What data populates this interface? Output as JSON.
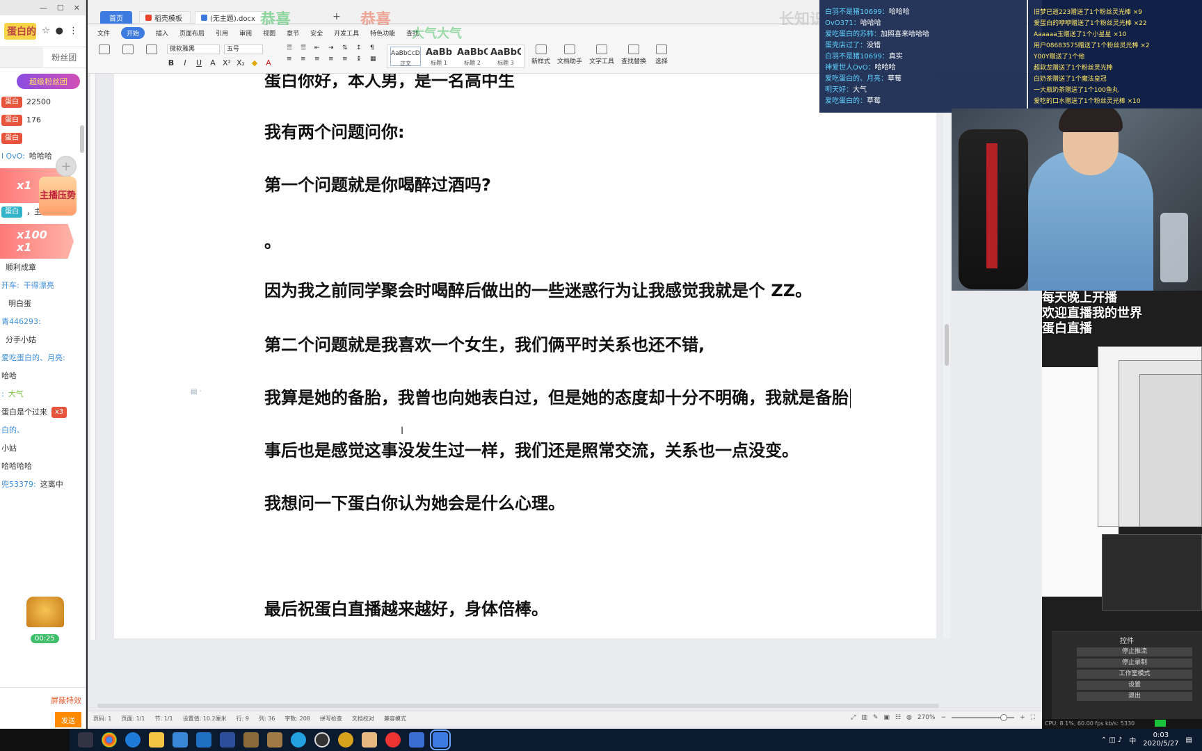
{
  "left_panel": {
    "logo_text": "蛋白的峡",
    "tabs": [
      "",
      "粉丝团"
    ],
    "banner": "超级粉丝团",
    "chat": [
      {
        "badge": "蛋白",
        "name": "",
        "msg": "22500"
      },
      {
        "badge": "蛋白",
        "name": "",
        "msg": "176"
      },
      {
        "badge": "蛋白",
        "name": "",
        "msg": ""
      },
      {
        "badge": "",
        "name": "l OvO:",
        "msg": "哈哈哈"
      },
      {
        "badge": "蛋白",
        "name": "",
        "msg": "，主播"
      },
      {
        "badge": "",
        "name": "",
        "msg": "顺利成章"
      },
      {
        "badge": "",
        "name": "开车:",
        "msg": "干得漂亮"
      },
      {
        "badge": "",
        "name": "",
        "msg": "明白蛋"
      },
      {
        "badge": "",
        "name": "青446293:",
        "msg": ""
      },
      {
        "badge": "",
        "name": "",
        "msg": "分手小姑"
      },
      {
        "badge": "",
        "name": "爱吃蛋白的、月亮:",
        "msg": ""
      },
      {
        "badge": "",
        "name": "",
        "msg": "哈哈"
      },
      {
        "badge": "",
        "name": ":",
        "msg": "大气"
      },
      {
        "badge": "",
        "name": "",
        "msg": "蛋白是个过来"
      },
      {
        "badge": "",
        "name": "白的、",
        "msg": ""
      },
      {
        "badge": "",
        "name": "",
        "msg": "小姑"
      },
      {
        "badge": "",
        "name": "",
        "msg": "哈哈哈哈"
      },
      {
        "badge": "",
        "name": "兜53379:",
        "msg": "这离中"
      }
    ],
    "gift_1": "x1",
    "gift_2": "x100",
    "gift_3": "x1",
    "mascot": "主播压势",
    "chest_badge": "x3",
    "timer": "00:25",
    "effect_label": "屏蔽特效",
    "send_label": "发送"
  },
  "wps": {
    "tabs": {
      "home": "首页",
      "docer": "稻壳模板",
      "doc": "(无主题).docx"
    },
    "overlay_1": "恭喜",
    "overlay_2": "恭喜",
    "overlay_3": "长知识了",
    "overlay_4": "大气大气",
    "menu": [
      "文件",
      "开始",
      "插入",
      "页面布局",
      "引用",
      "审阅",
      "视图",
      "章节",
      "安全",
      "开发工具",
      "特色功能",
      "查找"
    ],
    "active_menu": "开始",
    "font_name": "微软雅黑",
    "font_size": "五号",
    "styles": [
      {
        "preview": "AaBbCcDd",
        "name": "正文"
      },
      {
        "preview": "AaBb",
        "name": "标题 1"
      },
      {
        "preview": "AaBbC",
        "name": "标题 2"
      },
      {
        "preview": "AaBbC",
        "name": "标题 3"
      }
    ],
    "ribbon_tools": [
      "新样式",
      "文档助手",
      "文字工具",
      "查找替换",
      "选择"
    ],
    "document": [
      "蛋白你好，本人男，是一名高中生",
      "我有两个问题问你:",
      "第一个问题就是你喝醉过酒吗?",
      "。",
      "因为我之前同学聚会时喝醉后做出的一些迷惑行为让我感觉我就是个 ZZ。",
      "第二个问题就是我喜欢一个女生，我们俩平时关系也还不错,",
      "我算是她的备胎，我曾也向她表白过，但是她的态度却十分不明确，我就是备胎",
      "事后也是感觉这事没发生过一样，我们还是照常交流，关系也一点没变。",
      "我想问一下蛋白你认为她会是什么心理。",
      "最后祝蛋白直播越来越好，身体倍棒。"
    ],
    "status": [
      "页码: 1",
      "页面: 1/1",
      "节: 1/1",
      "设置值: 10.2厘米",
      "行: 9",
      "列: 36",
      "字数: 208",
      "拼写检查",
      "文档校对",
      "兼容模式"
    ],
    "zoom": "270%"
  },
  "stream": {
    "chat": [
      {
        "name": "白羽不是猪10699：",
        "msg": "哈哈哈"
      },
      {
        "name": "OvO371：",
        "msg": "哈哈哈"
      },
      {
        "name": "爱吃蛋白的苏柿：",
        "msg": "加照喜来哈哈哈"
      },
      {
        "name": "蛋壳店过了：",
        "msg": "没错"
      },
      {
        "name": "白羽不是猪10699：",
        "msg": "真实"
      },
      {
        "name": "神爱世人OvO：",
        "msg": "哈哈哈"
      },
      {
        "name": "爱吃蛋白的、月亮：",
        "msg": "草莓"
      },
      {
        "name": "明天好：",
        "msg": "大气"
      },
      {
        "name": "爱吃蛋白的：",
        "msg": "草莓"
      }
    ],
    "gifts": [
      "旧梦已逝223赠送了1个粉丝灵光棒 ×9",
      "爱蛋白的咿咿赠送了1个粉丝灵光棒 ×22",
      "Aaaaaa玉赠送了1个小星星 ×10",
      "用户08683575赠送了1个粉丝灵光棒 ×2",
      "Y00Y赠送了1个他",
      "超软龙赠送了1个粉丝灵光棒",
      "白奶茶赠送了1个魔法皇冠",
      "一大瓶奶茶赠送了1个100鱼丸",
      "爱吃的口水赠送了1个粉丝灵光棒 ×10"
    ],
    "obs_overlay": [
      "每天晚上开播",
      "欢迎直播我的世界",
      "蛋白直播"
    ],
    "obs_controls_title": "控件",
    "obs_controls": [
      "停止推流",
      "停止录制",
      "工作室模式",
      "设置",
      "退出"
    ],
    "obs_status": "CPU: 8.1%, 60.00 fps  kb/s: 5330"
  },
  "taskbar": {
    "time": "0:03",
    "date": "2020/5/27",
    "ime": "中"
  }
}
